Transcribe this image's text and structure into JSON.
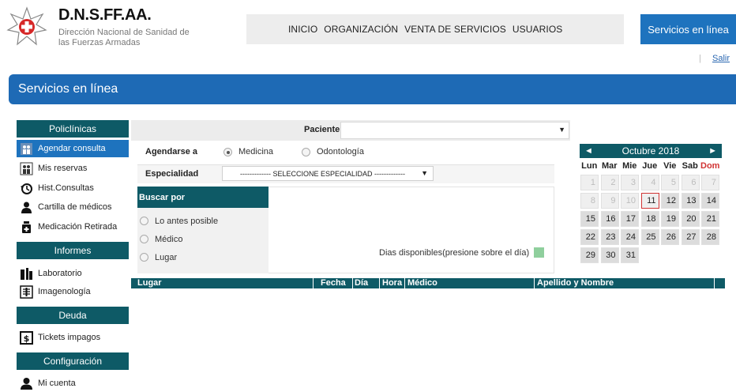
{
  "brand": {
    "title": "D.N.S.FF.AA.",
    "subtitle": "Dirección Nacional de Sanidad de las Fuerzas Armadas"
  },
  "nav": {
    "items": [
      "INICIO",
      "ORGANIZACIÓN",
      "VENTA DE SERVICIOS",
      "USUARIOS"
    ],
    "online_button": "Servicios en línea",
    "logout": "Salir",
    "logout_separator": "|"
  },
  "banner": {
    "title": "Servicios en línea"
  },
  "sidebar": {
    "sections": [
      {
        "title": "Policlínicas",
        "items": [
          "Agendar consulta",
          "Mis reservas",
          "Hist.Consultas",
          "Cartilla de médicos",
          "Medicación Retirada"
        ]
      },
      {
        "title": "Informes",
        "items": [
          "Laboratorio",
          "Imagenología"
        ]
      },
      {
        "title": "Deuda",
        "items": [
          "Tickets impagos"
        ]
      },
      {
        "title": "Configuración",
        "items": [
          "Mi cuenta"
        ]
      }
    ],
    "active_item": "Agendar consulta"
  },
  "form": {
    "paciente_label": "Paciente",
    "paciente_value": "",
    "agendarse_label": "Agendarse a",
    "agendarse_options": [
      "Medicina",
      "Odontología"
    ],
    "agendarse_selected": "Medicina",
    "especialidad_label": "Especialidad",
    "especialidad_value": "------------- SELECCIONE ESPECIALIDAD -------------",
    "buscar_label": "Buscar por",
    "buscar_options": [
      "Lo antes posible",
      "Médico",
      "Lugar"
    ],
    "dias_disponibles": "Dias disponibles(presione sobre el día)",
    "dias_color": "#8fcf9d"
  },
  "calendar": {
    "month_label": "Octubre 2018",
    "prev": "◄",
    "next": "►",
    "weekdays": [
      "Lun",
      "Mar",
      "Mie",
      "Jue",
      "Vie",
      "Sab",
      "Dom"
    ],
    "weeks": [
      [
        "1",
        "2",
        "3",
        "4",
        "5",
        "6",
        "7"
      ],
      [
        "8",
        "9",
        "10",
        "11",
        "12",
        "13",
        "14"
      ],
      [
        "15",
        "16",
        "17",
        "18",
        "19",
        "20",
        "21"
      ],
      [
        "22",
        "23",
        "24",
        "25",
        "26",
        "27",
        "28"
      ],
      [
        "29",
        "30",
        "31",
        "",
        "",
        "",
        ""
      ]
    ],
    "today": "11",
    "sunday_color": "#d13333"
  },
  "results": {
    "columns": [
      "Lugar",
      "Fecha",
      "Día",
      "Hora",
      "Médico",
      "Apellido y Nombre"
    ]
  },
  "colors": {
    "primary": "#1e73be",
    "dark_teal": "#0e5a66"
  }
}
